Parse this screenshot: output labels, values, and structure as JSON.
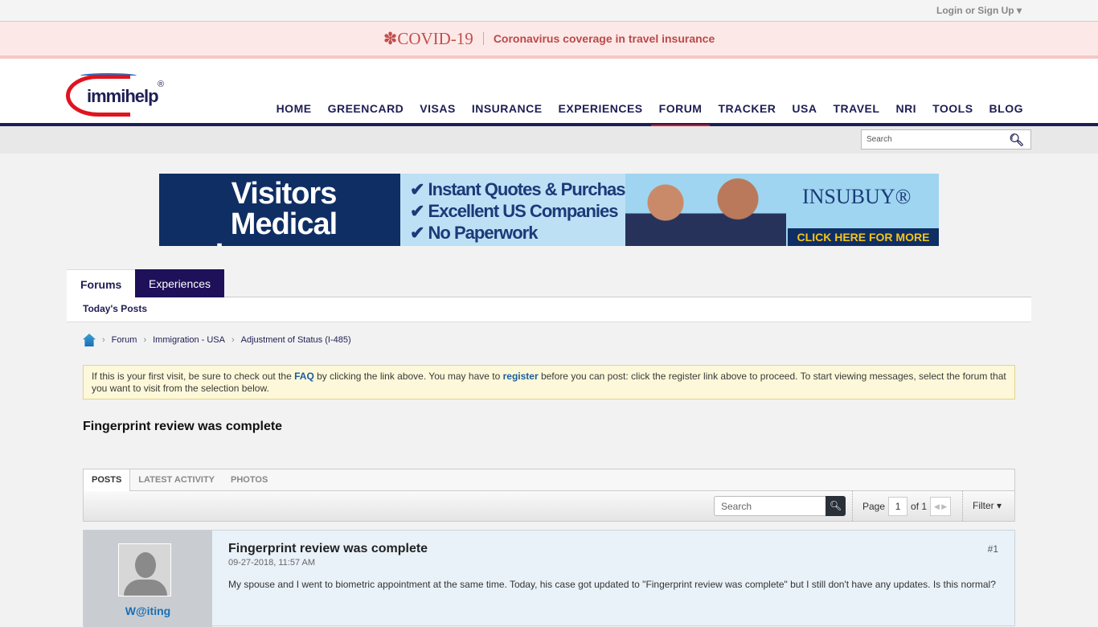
{
  "topbar": {
    "login": "Login or Sign Up ▾"
  },
  "covid": {
    "title": "✽COVID-19",
    "link": "Coronavirus coverage in travel insurance"
  },
  "logo": {
    "text": "immihelp",
    "reg": "®"
  },
  "nav": [
    "HOME",
    "GREENCARD",
    "VISAS",
    "INSURANCE",
    "EXPERIENCES",
    "FORUM",
    "TRACKER",
    "USA",
    "TRAVEL",
    "NRI",
    "TOOLS",
    "BLOG"
  ],
  "nav_active": "FORUM",
  "site_search": {
    "placeholder": "Search"
  },
  "ad": {
    "headline1": "Visitors",
    "headline2": "Medical Insurance",
    "points": [
      "✔ Instant Quotes & Purchase",
      "✔ Excellent US Companies",
      "✔ No Paperwork"
    ],
    "brand": "INSUBUY®",
    "cta": "CLICK HERE FOR MORE"
  },
  "tabs": {
    "forums": "Forums",
    "experiences": "Experiences",
    "todays_posts": "Today's Posts"
  },
  "breadcrumb": [
    "Forum",
    "Immigration - USA",
    "Adjustment of Status (I-485)"
  ],
  "notice": {
    "t1": "If this is your first visit, be sure to check out the ",
    "faq": "FAQ",
    "t2": " by clicking the link above. You may have to ",
    "register": "register",
    "t3": " before you can post: click the register link above to proceed. To start viewing messages, select the forum that you want to visit from the selection below."
  },
  "thread_title": "Fingerprint review was complete",
  "panel": {
    "tabs": [
      "POSTS",
      "LATEST ACTIVITY",
      "PHOTOS"
    ],
    "search_placeholder": "Search",
    "page_label": "Page",
    "page": "1",
    "of": "of 1",
    "filter": "Filter ▾"
  },
  "post": {
    "author": "W@iting",
    "title": "Fingerprint review was complete",
    "date": "09-27-2018, 11:57 AM",
    "number": "#1",
    "text": "My spouse and I went to biometric appointment at the same time. Today, his case got updated to \"Fingerprint review was complete\" but I still don't have any updates. Is this normal?"
  }
}
